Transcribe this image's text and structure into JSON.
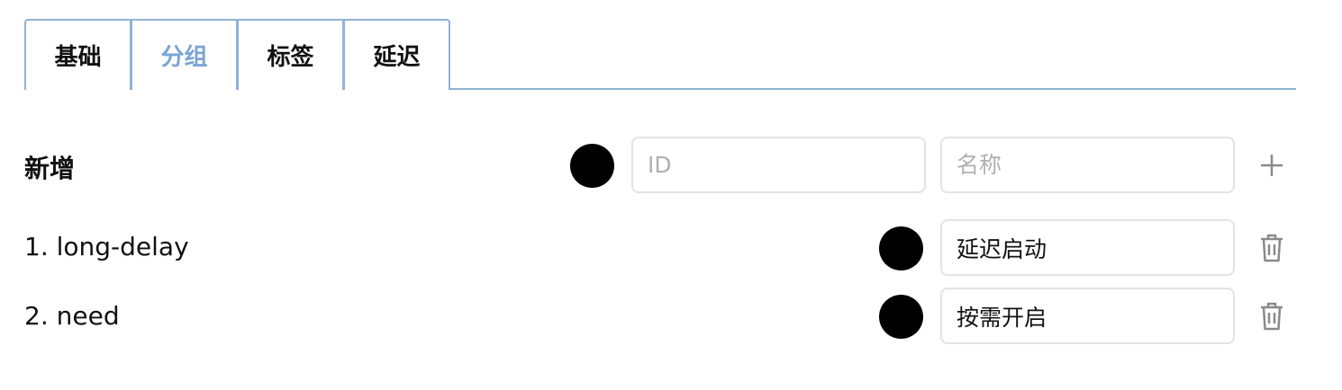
{
  "tabs": [
    {
      "label": "基础",
      "active": false
    },
    {
      "label": "分组",
      "active": true
    },
    {
      "label": "标签",
      "active": false
    },
    {
      "label": "延迟",
      "active": false
    }
  ],
  "new_row": {
    "label": "新增",
    "id_placeholder": "ID",
    "name_placeholder": "名称",
    "add_icon": "plus-icon"
  },
  "groups": [
    {
      "label": "1. long-delay",
      "name_value": "延迟启动"
    },
    {
      "label": "2. need",
      "name_value": "按需开启"
    }
  ],
  "colors": {
    "accent": "#7aa5d4",
    "tab_border": "#8fb3d6",
    "dot": "#000000",
    "icon": "#8a8a8a"
  }
}
